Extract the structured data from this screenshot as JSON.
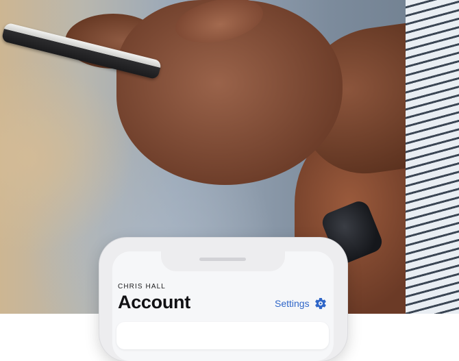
{
  "account": {
    "user_name": "CHRIS HALL",
    "title": "Account",
    "settings_label": "Settings"
  },
  "icons": {
    "settings": "gear-icon"
  },
  "colors": {
    "accent": "#2f66c8",
    "title": "#111114",
    "screen_background": "#f6f7f9",
    "phone_frame": "#ededef"
  }
}
